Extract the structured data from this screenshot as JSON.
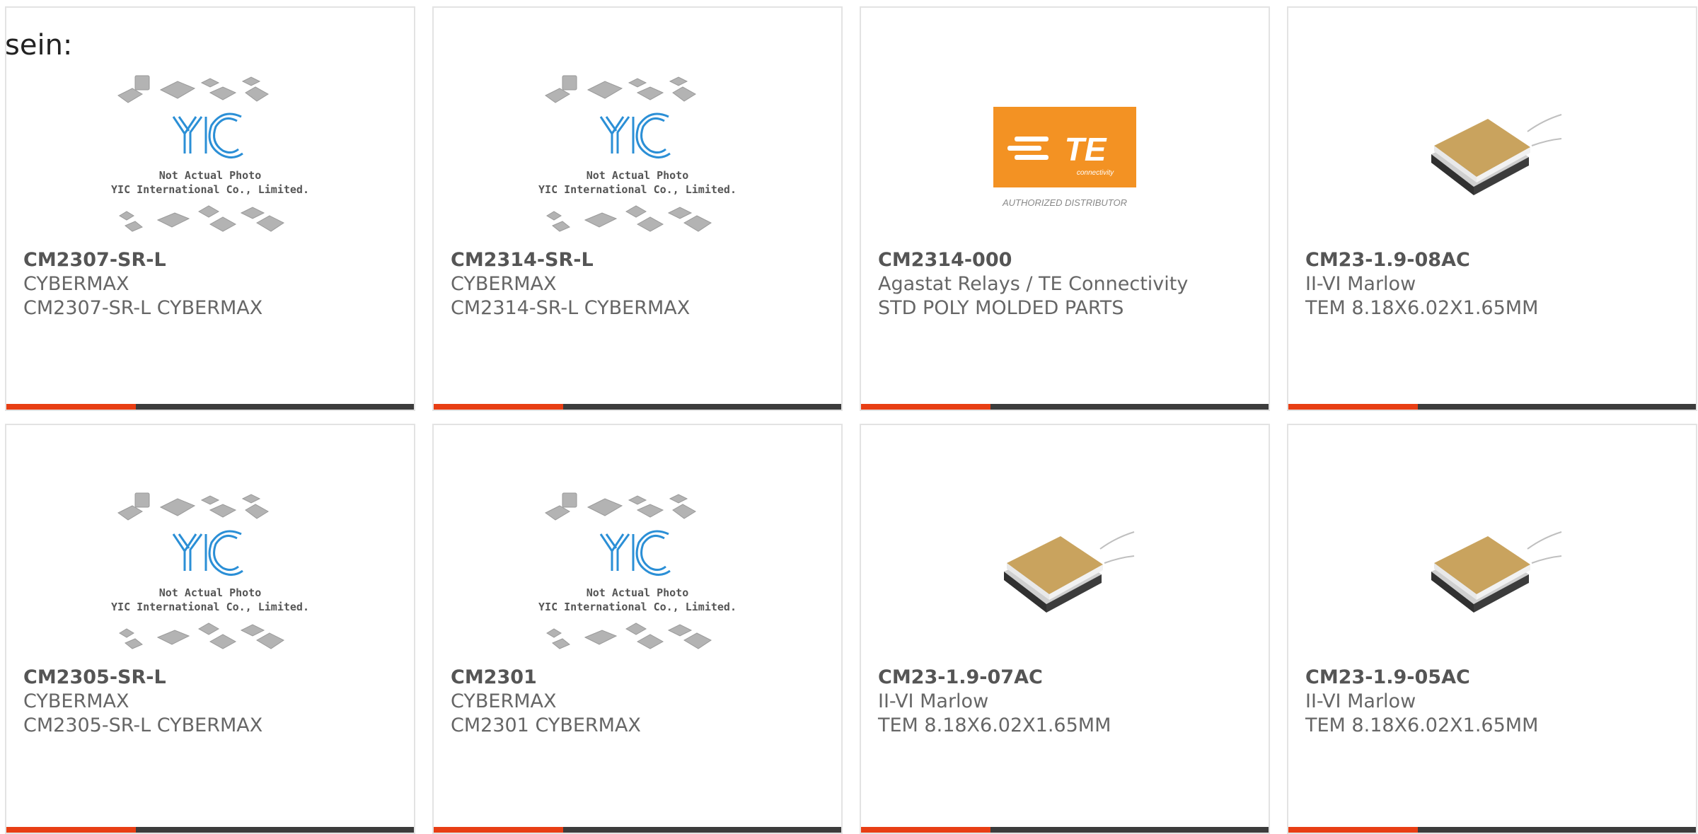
{
  "intro_text": "sein:",
  "colors": {
    "accent": "#e83e14",
    "bar": "#3c3c3c",
    "yic_blue": "#2b8fd6",
    "te_orange": "#f39223"
  },
  "placeholder": {
    "line1": "Not Actual Photo",
    "line2": "YIC International Co., Limited.",
    "logo": "YIC"
  },
  "te_logo": {
    "mark": "TE",
    "sub": "connectivity",
    "footer": "AUTHORIZED DISTRIBUTOR"
  },
  "products": [
    {
      "part_number": "CM2307-SR-L",
      "manufacturer": "CYBERMAX",
      "description": "CM2307-SR-L CYBERMAX",
      "image": "yic-placeholder"
    },
    {
      "part_number": "CM2314-SR-L",
      "manufacturer": "CYBERMAX",
      "description": "CM2314-SR-L CYBERMAX",
      "image": "yic-placeholder"
    },
    {
      "part_number": "CM2314-000",
      "manufacturer": "Agastat Relays / TE Connectivity",
      "description": "STD POLY MOLDED PARTS",
      "image": "te-logo"
    },
    {
      "part_number": "CM23-1.9-08AC",
      "manufacturer": "II-VI Marlow",
      "description": "TEM 8.18X6.02X1.65MM",
      "image": "tec-module"
    },
    {
      "part_number": "CM2305-SR-L",
      "manufacturer": "CYBERMAX",
      "description": "CM2305-SR-L CYBERMAX",
      "image": "yic-placeholder"
    },
    {
      "part_number": "CM2301",
      "manufacturer": "CYBERMAX",
      "description": "CM2301 CYBERMAX",
      "image": "yic-placeholder"
    },
    {
      "part_number": "CM23-1.9-07AC",
      "manufacturer": "II-VI Marlow",
      "description": "TEM 8.18X6.02X1.65MM",
      "image": "tec-module"
    },
    {
      "part_number": "CM23-1.9-05AC",
      "manufacturer": "II-VI Marlow",
      "description": "TEM 8.18X6.02X1.65MM",
      "image": "tec-module"
    }
  ]
}
